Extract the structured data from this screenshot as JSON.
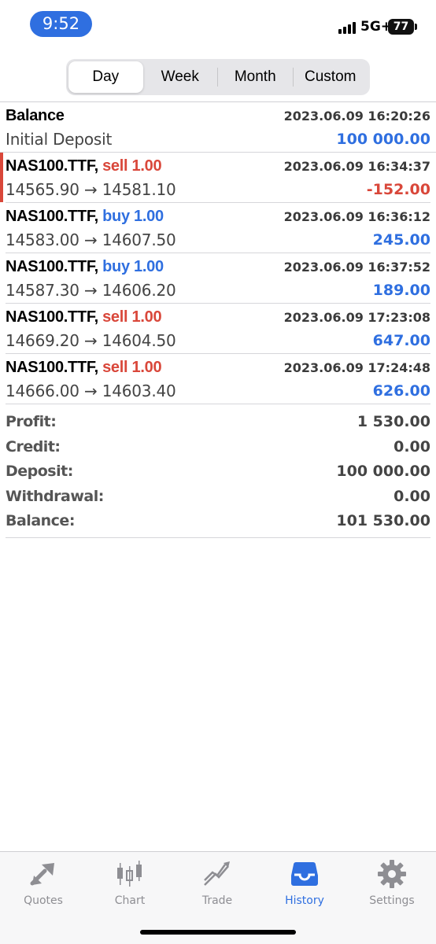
{
  "status": {
    "time": "9:52",
    "network": "5G+",
    "battery": "77"
  },
  "periods": [
    {
      "label": "Day",
      "active": true
    },
    {
      "label": "Week",
      "active": false
    },
    {
      "label": "Month",
      "active": false
    },
    {
      "label": "Custom",
      "active": false
    }
  ],
  "balance_entry": {
    "title": "Balance",
    "subtitle": "Initial Deposit",
    "datetime": "2023.06.09 16:20:26",
    "amount": "100 000.00"
  },
  "deals": [
    {
      "symbol": "NAS100.TTF,",
      "side": "sell",
      "volume": "1.00",
      "prices": "14565.90 → 14581.10",
      "datetime": "2023.06.09 16:34:37",
      "profit": "-152.00"
    },
    {
      "symbol": "NAS100.TTF,",
      "side": "buy",
      "volume": "1.00",
      "prices": "14583.00 → 14607.50",
      "datetime": "2023.06.09 16:36:12",
      "profit": "245.00"
    },
    {
      "symbol": "NAS100.TTF,",
      "side": "buy",
      "volume": "1.00",
      "prices": "14587.30 → 14606.20",
      "datetime": "2023.06.09 16:37:52",
      "profit": "189.00"
    },
    {
      "symbol": "NAS100.TTF,",
      "side": "sell",
      "volume": "1.00",
      "prices": "14669.20 → 14604.50",
      "datetime": "2023.06.09 17:23:08",
      "profit": "647.00"
    },
    {
      "symbol": "NAS100.TTF,",
      "side": "sell",
      "volume": "1.00",
      "prices": "14666.00 → 14603.40",
      "datetime": "2023.06.09 17:24:48",
      "profit": "626.00"
    }
  ],
  "summary": {
    "profit_label": "Profit:",
    "profit": "1 530.00",
    "credit_label": "Credit:",
    "credit": "0.00",
    "deposit_label": "Deposit:",
    "deposit": "100 000.00",
    "withdrawal_label": "Withdrawal:",
    "withdrawal": "0.00",
    "balance_label": "Balance:",
    "balance": "101 530.00"
  },
  "tabs": [
    {
      "label": "Quotes",
      "icon": "quotes-icon",
      "active": false
    },
    {
      "label": "Chart",
      "icon": "candlestick-icon",
      "active": false
    },
    {
      "label": "Trade",
      "icon": "trade-icon",
      "active": false
    },
    {
      "label": "History",
      "icon": "inbox-tray-icon",
      "active": true
    },
    {
      "label": "Settings",
      "icon": "gear-icon",
      "active": false
    }
  ],
  "colors": {
    "accent": "#2f6fe0",
    "sell": "#d9473a",
    "inactive": "#8e8e93"
  }
}
